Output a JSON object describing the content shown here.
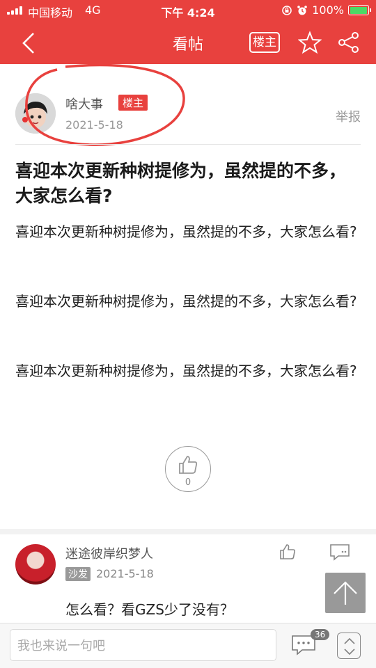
{
  "status_bar": {
    "carrier": "中国移动",
    "network": "4G",
    "time": "下午 4:24",
    "battery": "100%",
    "battery_level": 1.0
  },
  "nav": {
    "title": "看帖",
    "owner_label": "楼主",
    "back_icon": "back-chevron-icon",
    "star_icon": "star-icon",
    "share_icon": "share-icon"
  },
  "author": {
    "name": "啥大事",
    "badge": "楼主",
    "date": "2021-5-18",
    "report": "举报"
  },
  "post": {
    "title": "喜迎本次更新种树提修为，虽然提的不多，大家怎么看?",
    "paragraphs": [
      "喜迎本次更新种树提修为，虽然提的不多，大家怎么看?",
      "喜迎本次更新种树提修为，虽然提的不多，大家怎么看?",
      "喜迎本次更新种树提修为，虽然提的不多，大家怎么看?"
    ],
    "like_count": "0"
  },
  "comment": {
    "name": "迷途彼岸织梦人",
    "tag": "沙发",
    "date": "2021-5-18",
    "text": "怎么看？看GZS少了没有？"
  },
  "bottom": {
    "input_placeholder": "我也来说一句吧",
    "comment_count": "36"
  },
  "colors": {
    "brand_red": "#e8413e",
    "annotation_circle": "#e8413e"
  }
}
